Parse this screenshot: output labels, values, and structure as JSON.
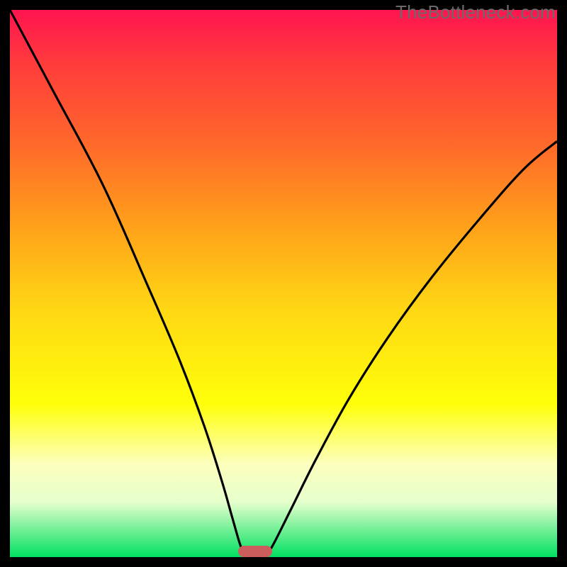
{
  "watermark": "TheBottleneck.com",
  "chart_data": {
    "type": "line",
    "title": "",
    "xlabel": "",
    "ylabel": "",
    "xlim": [
      0,
      100
    ],
    "ylim": [
      0,
      100
    ],
    "background_gradient": {
      "top": "#ff1450",
      "mid": "#ffff0a",
      "bottom": "#00e060"
    },
    "series": [
      {
        "name": "left-curve",
        "x": [
          0,
          8,
          17,
          25,
          31,
          35.5,
          38.7,
          40.7,
          42.0,
          42.8,
          43.0
        ],
        "y": [
          100,
          85,
          68,
          50,
          36,
          24,
          14,
          7,
          2.5,
          0.5,
          0
        ]
      },
      {
        "name": "right-curve",
        "x": [
          46.8,
          48.5,
          51.5,
          56,
          62,
          69,
          77,
          86,
          94,
          100
        ],
        "y": [
          0,
          3,
          9,
          18,
          29,
          40,
          51,
          62,
          71,
          76
        ]
      }
    ],
    "marker": {
      "name": "optimal-range-marker",
      "x_center": 44.8,
      "y": 0,
      "width_pct": 6.2,
      "color": "#cb5d5d"
    }
  },
  "frame": {
    "border_color": "#000000",
    "border_width_px": 14
  }
}
